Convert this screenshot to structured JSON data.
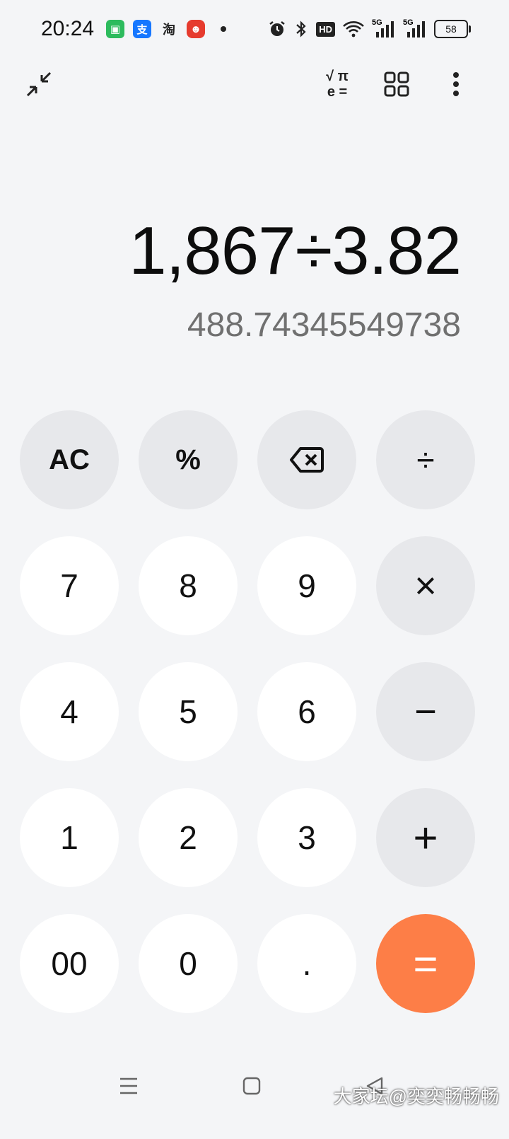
{
  "status_bar": {
    "time": "20:24",
    "notifications": [
      {
        "name": "message-app-icon",
        "glyph": "▣"
      },
      {
        "name": "alipay-app-icon",
        "glyph": "支"
      },
      {
        "name": "taobao-app-icon",
        "glyph": "淘"
      },
      {
        "name": "mascot-app-icon",
        "glyph": "☻"
      }
    ],
    "hd_label": "HD",
    "signal_1_label": "5G",
    "signal_2_label": "5G",
    "battery": "58"
  },
  "toolbar": {
    "scientific_label_top": "√ π",
    "scientific_label_bottom": "e ="
  },
  "display": {
    "expression": "1,867÷3.82",
    "result": "488.74345549738"
  },
  "keys": {
    "ac": "AC",
    "percent": "%",
    "divide": "÷",
    "seven": "7",
    "eight": "8",
    "nine": "9",
    "multiply": "×",
    "four": "4",
    "five": "5",
    "six": "6",
    "minus": "−",
    "one": "1",
    "two": "2",
    "three": "3",
    "plus": "+",
    "double_zero": "00",
    "zero": "0",
    "decimal": ".",
    "equals": "="
  },
  "colors": {
    "accent": "#fd7e47",
    "operator_bg": "#e7e8eb",
    "digit_bg": "#ffffff",
    "background": "#f4f5f7"
  },
  "watermark": "大家坛@奕奕畅畅畅"
}
